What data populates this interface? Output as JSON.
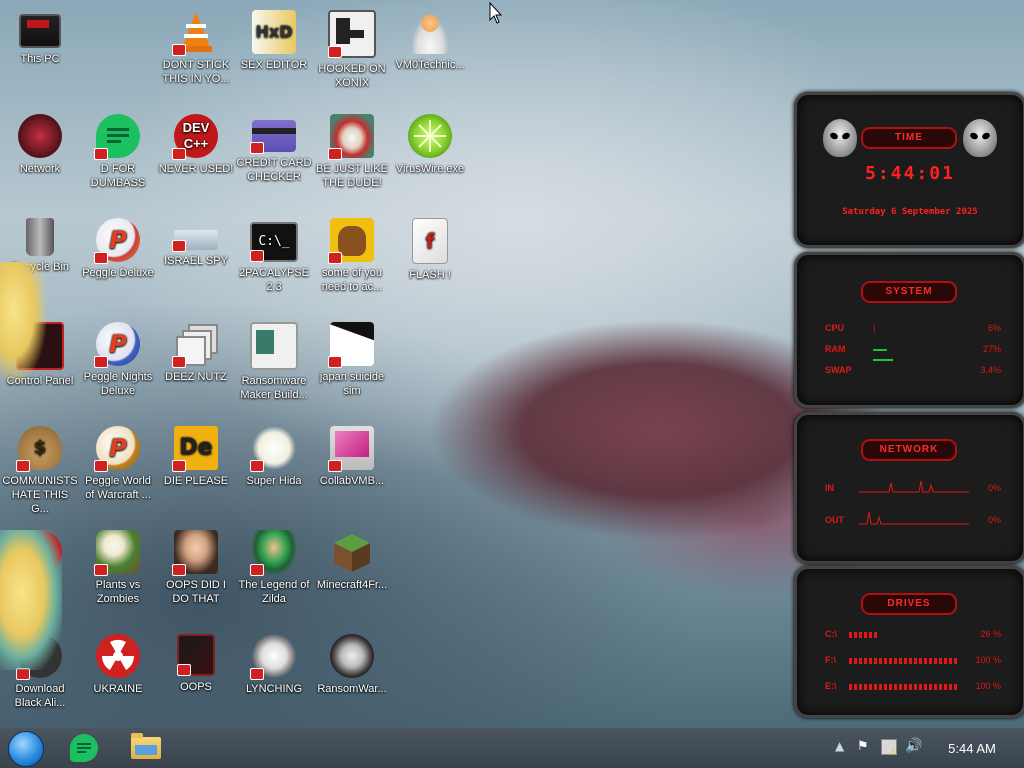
{
  "desktop": {
    "icons": [
      {
        "label": "This PC"
      },
      {
        "label": "DONT STICK THIS IN YO..."
      },
      {
        "label": "SEX EDITOR"
      },
      {
        "label": "HOOKED ON XONIX"
      },
      {
        "label": "VM0Technic..."
      },
      {
        "label": "Network"
      },
      {
        "label": "D FOR DUMBASS"
      },
      {
        "label": "NEVER USED!"
      },
      {
        "label": "CREDIT CARD CHECKER"
      },
      {
        "label": "BE JUST LIKE THE DUDE!"
      },
      {
        "label": "VirusWire.exe"
      },
      {
        "label": "Recycle Bin"
      },
      {
        "label": "Peggle Deluxe"
      },
      {
        "label": "ISRAEL SPY"
      },
      {
        "label": "2PACALYPSE 2.3"
      },
      {
        "label": "some of you need to ac..."
      },
      {
        "label": "FLASH !"
      },
      {
        "label": "Control Panel"
      },
      {
        "label": "Peggle Nights Deluxe"
      },
      {
        "label": "DEEZ NUTZ"
      },
      {
        "label": "Ransomware Maker Build..."
      },
      {
        "label": "japan suicide sim"
      },
      {
        "label": "COMMUNISTS HATE THIS G..."
      },
      {
        "label": "Peggle World of Warcraft ..."
      },
      {
        "label": "DIE PLEASE"
      },
      {
        "label": "Super Hida"
      },
      {
        "label": "CollabVMB..."
      },
      {
        "label": "N"
      },
      {
        "label": "Plants vs Zombies"
      },
      {
        "label": "OOPS DID I DO THAT"
      },
      {
        "label": "The Legend of Zilda"
      },
      {
        "label": "Minecraft4Fr..."
      },
      {
        "label": "Download Black Ali..."
      },
      {
        "label": "UKRAINE"
      },
      {
        "label": "OOPS"
      },
      {
        "label": "LYNCHING"
      },
      {
        "label": "RansomWar..."
      }
    ]
  },
  "widget": {
    "time": {
      "title": "TIME",
      "clock": "5:44:01",
      "date": "Saturday 6 September 2025"
    },
    "system": {
      "title": "SYSTEM",
      "rows": [
        {
          "key": "CPU",
          "value": "6%"
        },
        {
          "key": "RAM",
          "value": "27%"
        },
        {
          "key": "SWAP",
          "value": "3.4%"
        }
      ]
    },
    "network": {
      "title": "NETWORK",
      "rows": [
        {
          "key": "IN",
          "value": "0%"
        },
        {
          "key": "OUT",
          "value": "0%"
        }
      ]
    },
    "drives": {
      "title": "DRIVES",
      "rows": [
        {
          "key": "C:\\",
          "value": "26 %",
          "fill": 0.26
        },
        {
          "key": "F:\\",
          "value": "100 %",
          "fill": 1.0
        },
        {
          "key": "E:\\",
          "value": "100 %",
          "fill": 1.0
        }
      ]
    }
  },
  "taskbar": {
    "clock": "5:44 AM",
    "colors": {
      "accent": "#ff2020",
      "taskbar": "#3e4852"
    }
  }
}
